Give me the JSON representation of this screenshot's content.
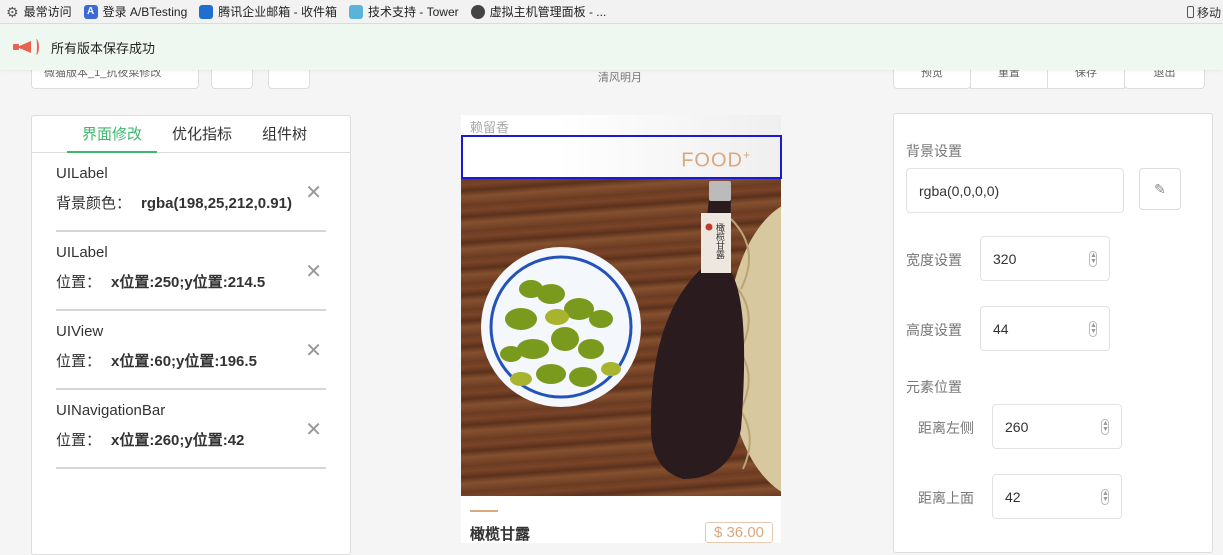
{
  "bookmarks": [
    {
      "icon": "gear-icon",
      "label": "最常访问"
    },
    {
      "icon": "ab-icon",
      "label": "登录 A/BTesting"
    },
    {
      "icon": "mail-icon",
      "label": "腾讯企业邮箱 - 收件箱"
    },
    {
      "icon": "tower-icon",
      "label": "技术支持 - Tower"
    },
    {
      "icon": "vm-icon",
      "label": "虚拟主机管理面板 - ..."
    }
  ],
  "bookmarks_right": "移动",
  "toast": {
    "message": "所有版本保存成功",
    "icon": "megaphone-icon",
    "color": "#e9624e"
  },
  "top_controls": {
    "version_select": "微猫版本_1_抗夜菜修改",
    "center_title": "清风明月",
    "right_buttons": [
      "预览",
      "重置",
      "保存",
      "退出"
    ]
  },
  "left_panel": {
    "tabs": [
      "界面修改",
      "优化指标",
      "组件树"
    ],
    "active_tab": 0,
    "accent": "#3fb86e",
    "changes": [
      {
        "type": "UILabel",
        "label": "背景颜色：",
        "value": "rgba(198,25,212,0.91)"
      },
      {
        "type": "UILabel",
        "label": "位置：",
        "value": "x位置:250;y位置:214.5"
      },
      {
        "type": "UIView",
        "label": "位置：",
        "value": "x位置:60;y位置:196.5"
      },
      {
        "type": "UINavigationBar",
        "label": "位置：",
        "value": "x位置:260;y位置:42"
      }
    ]
  },
  "preview": {
    "shop_name": "赖留香",
    "logo": "FOOD",
    "logo_mark": "+",
    "product_name": "橄榄甘露",
    "price": "$ 36.00",
    "bottle_label": "橄榄甘露",
    "selection_color": "#1a1ad6"
  },
  "right_panel": {
    "bg_label": "背景设置",
    "bg_value": "rgba(0,0,0,0)",
    "width_label": "宽度设置",
    "width_value": "320",
    "height_label": "高度设置",
    "height_value": "44",
    "position_label": "元素位置",
    "left_label": "距离左侧",
    "left_value": "260",
    "top_label": "距离上面",
    "top_value": "42"
  }
}
